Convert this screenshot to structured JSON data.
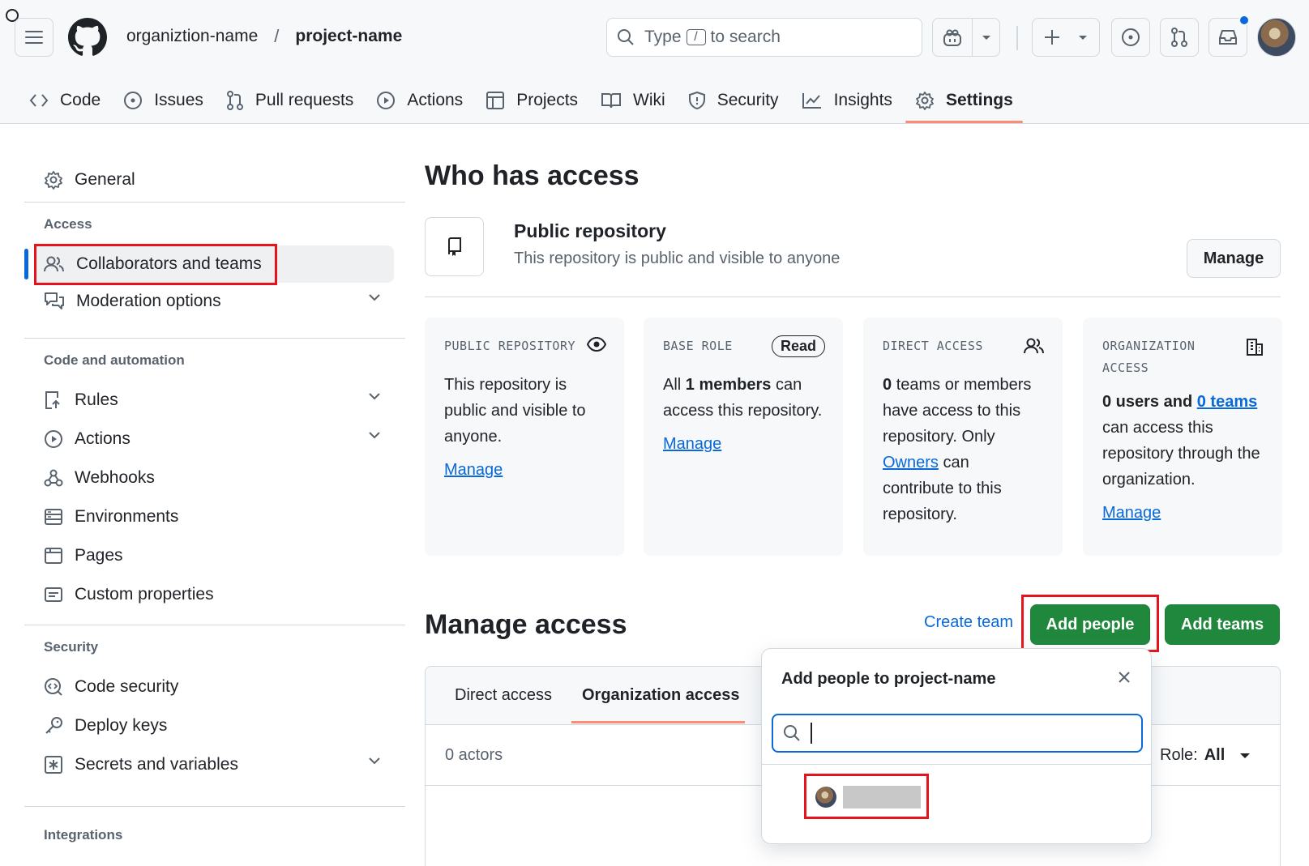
{
  "header": {
    "org": "organiztion-name",
    "separator": "/",
    "repo": "project-name",
    "search": {
      "prefix": "Type",
      "key": "/",
      "suffix": "to search"
    }
  },
  "repo_nav": [
    {
      "label": "Code",
      "icon": "code-icon"
    },
    {
      "label": "Issues",
      "icon": "issue-icon"
    },
    {
      "label": "Pull requests",
      "icon": "pull-request-icon"
    },
    {
      "label": "Actions",
      "icon": "play-icon"
    },
    {
      "label": "Projects",
      "icon": "table-icon"
    },
    {
      "label": "Wiki",
      "icon": "book-icon"
    },
    {
      "label": "Security",
      "icon": "shield-icon"
    },
    {
      "label": "Insights",
      "icon": "graph-icon"
    },
    {
      "label": "Settings",
      "icon": "gear-icon",
      "active": true
    }
  ],
  "sidebar": {
    "general": "General",
    "sections": {
      "access": "Access",
      "code_automation": "Code and automation",
      "security": "Security",
      "integrations": "Integrations"
    },
    "items": {
      "collaborators": "Collaborators and teams",
      "moderation": "Moderation options",
      "rules": "Rules",
      "actions": "Actions",
      "webhooks": "Webhooks",
      "environments": "Environments",
      "pages": "Pages",
      "custom_properties": "Custom properties",
      "code_security": "Code security",
      "deploy_keys": "Deploy keys",
      "secrets": "Secrets and variables"
    }
  },
  "main": {
    "title": "Who has access",
    "public_title": "Public repository",
    "public_sub": "This repository is public and visible to anyone",
    "manage": "Manage",
    "cards": {
      "public": {
        "head": "PUBLIC REPOSITORY",
        "body": "This repository is public and visible to anyone.",
        "link": "Manage"
      },
      "base": {
        "head": "BASE ROLE",
        "badge": "Read",
        "body_pre": "All",
        "body_bold": "1 members",
        "body_post": "can access this repository.",
        "link": "Manage"
      },
      "direct": {
        "head": "DIRECT ACCESS",
        "body_bold": "0",
        "body_1": "teams or members have access to this repository. Only",
        "owners": "Owners",
        "body_2": "can contribute to this repository."
      },
      "org": {
        "head1": "ORGANIZATION",
        "head2": "ACCESS",
        "body_bold": "0 users and",
        "teams_link": "0 teams",
        "body": "can access this repository through the organization.",
        "link": "Manage"
      }
    },
    "manage_access": "Manage access",
    "create_team": "Create team",
    "add_people": "Add people",
    "add_teams": "Add teams",
    "tabs": [
      "Direct access",
      "Organization access"
    ],
    "actors": "0 actors",
    "role_label": "Role:",
    "role_value": "All"
  },
  "popup": {
    "title": "Add people to project-name",
    "input_value": ""
  },
  "colors": {
    "accent": "#0969da",
    "green": "#1f883d",
    "highlight": "#e5141c",
    "tab_underline": "#fd8c73"
  }
}
